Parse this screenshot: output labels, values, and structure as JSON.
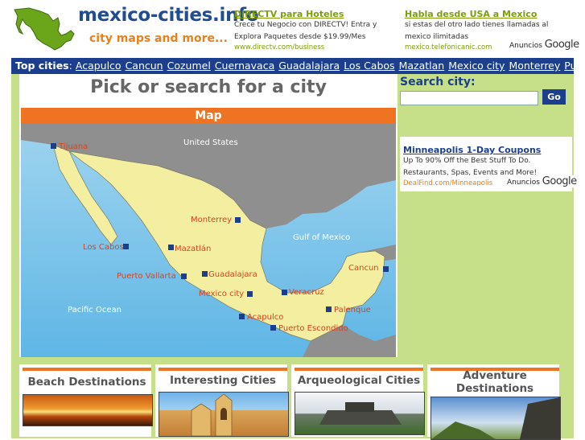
{
  "header": {
    "logo_title": "mexico-cities.info",
    "logo_tagline": "city maps and more...",
    "ad1": {
      "title": "DIRECTV para Hoteles",
      "body": "Crece tu Negocio con DIRECTV! Entra y Explora Paquetes desde $19.99/Mes",
      "url": "www.directv.com/business"
    },
    "ad2": {
      "title": "Habla desde USA a Mexico",
      "body": "si estas del otro lado tienes llamadas al mexico ilimitadas",
      "url": "mexico.telefonicanic.com"
    },
    "ads_by": "Anuncios",
    "ads_brand": "Google"
  },
  "nav": {
    "label": "Top cities",
    "separator": ":",
    "cities": [
      "Acapulco",
      "Cancun",
      "Cozumel",
      "Cuernavaca",
      "Guadalajara",
      "Los Cabos",
      "Mazatlan",
      "Mexico city",
      "Monterrey",
      "Puerto Vallarta"
    ]
  },
  "main": {
    "title": "Pick or search for a city",
    "map_header": "Map",
    "map": {
      "country_label": "United States",
      "gulf_label": "Gulf of Mexico",
      "ocean_label": "Pacific Ocean",
      "cities": [
        "Tijuana",
        "Monterrey",
        "Los Cabos",
        "Mazatlán",
        "Puerto Vallarta",
        "Guadalajara",
        "Mexico city",
        "Veracruz",
        "Cancun",
        "Acapulco",
        "Palenque",
        "Puerto Escondido"
      ]
    }
  },
  "sidebar": {
    "search_label": "Search city:",
    "search_value": "",
    "go_label": "Go",
    "ad": {
      "title": "Minneapolis 1-Day Coupons",
      "body": "Up To 90% Off the Best Stuff To Do. Restaurants, Spas, Events and More!",
      "url": "DealFind.com/Minneapolis"
    },
    "ads_by": "Anuncios",
    "ads_brand": "Google"
  },
  "destinations": [
    "Beach Destinations",
    "Interesting Cities",
    "Arqueological Cities",
    "Adventure Destinations"
  ],
  "colors": {
    "brand_blue": "#1b3f8c",
    "accent_orange": "#ee7322",
    "body_green": "#c6e08a",
    "ad_green": "#7a9f0a"
  }
}
